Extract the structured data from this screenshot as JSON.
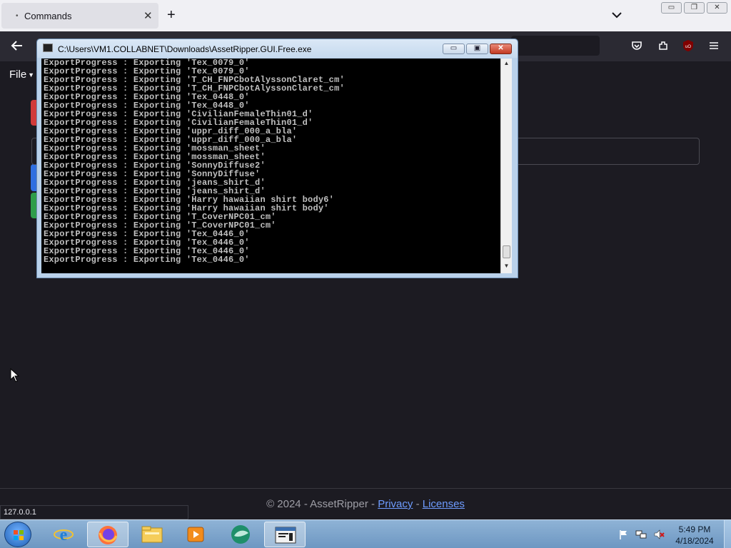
{
  "browser": {
    "tab": {
      "title": "Commands"
    },
    "window_controls": {
      "minimize": "▭",
      "maximize": "❐",
      "close": "✕"
    }
  },
  "page": {
    "file_menu": "File",
    "footer": {
      "copyright": "© 2024 - AssetRipper -",
      "separator": "-",
      "privacy": "Privacy",
      "licenses": "Licenses"
    },
    "status_url": "127.0.0.1"
  },
  "console": {
    "title": "C:\\Users\\VM1.COLLABNET\\Downloads\\AssetRipper.GUI.Free.exe",
    "lines": [
      "ExportProgress : Exporting 'Tex_0079_0'",
      "ExportProgress : Exporting 'Tex_0079_0'",
      "ExportProgress : Exporting 'T_CH_FNPCbotAlyssonClaret_cm'",
      "ExportProgress : Exporting 'T_CH_FNPCbotAlyssonClaret_cm'",
      "ExportProgress : Exporting 'Tex_0448_0'",
      "ExportProgress : Exporting 'Tex_0448_0'",
      "ExportProgress : Exporting 'CivilianFemaleThin01_d'",
      "ExportProgress : Exporting 'CivilianFemaleThin01_d'",
      "ExportProgress : Exporting 'uppr_diff_000_a_bla'",
      "ExportProgress : Exporting 'uppr_diff_000_a_bla'",
      "ExportProgress : Exporting 'mossman_sheet'",
      "ExportProgress : Exporting 'mossman_sheet'",
      "ExportProgress : Exporting 'SonnyDiffuse2'",
      "ExportProgress : Exporting 'SonnyDiffuse'",
      "ExportProgress : Exporting 'jeans_shirt_d'",
      "ExportProgress : Exporting 'jeans_shirt_d'",
      "ExportProgress : Exporting 'Harry hawaiian shirt body6'",
      "ExportProgress : Exporting 'Harry hawaiian shirt body'",
      "ExportProgress : Exporting 'T_CoverNPC01_cm'",
      "ExportProgress : Exporting 'T_CoverNPC01_cm'",
      "ExportProgress : Exporting 'Tex_0446_0'",
      "ExportProgress : Exporting 'Tex_0446_0'",
      "ExportProgress : Exporting 'Tex_0446_0'",
      "ExportProgress : Exporting 'Tex_0446_0'"
    ]
  },
  "taskbar": {
    "clock_time": "5:49 PM",
    "clock_date": "4/18/2024",
    "apps": [
      "internet-explorer-icon",
      "firefox-icon",
      "file-explorer-icon",
      "media-player-icon",
      "app-icon",
      "console-app-icon"
    ]
  },
  "colors": {
    "page_bg": "#1c1b22",
    "toolbar_bg": "#2b2a33",
    "link": "#6e9cff",
    "accent_red": "#d13a3a",
    "accent_blue": "#2f6fe0",
    "accent_green": "#2e9d4a"
  }
}
